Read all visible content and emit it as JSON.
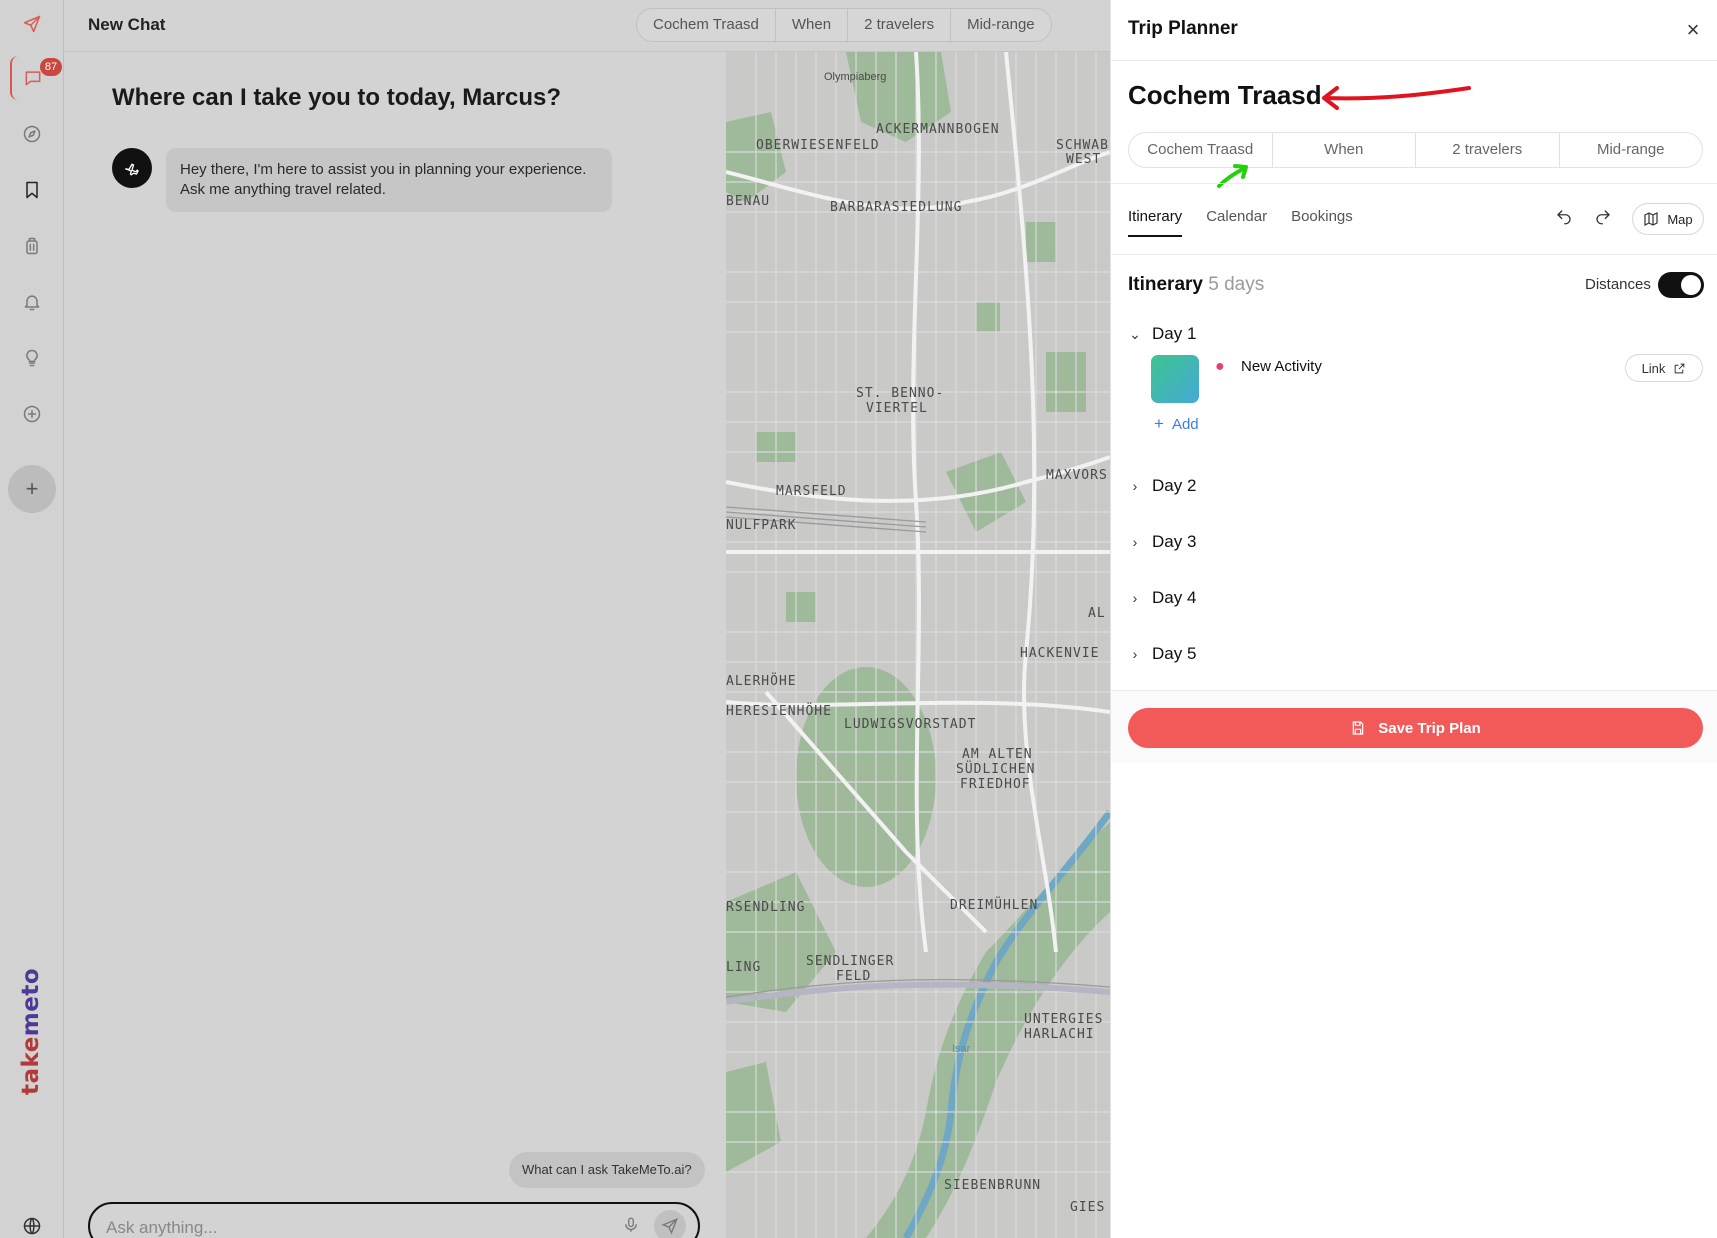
{
  "rail": {
    "badge_count": "87",
    "logo_part1": "take",
    "logo_part2": "meto"
  },
  "topbar": {
    "title": "New Chat",
    "pills": [
      "Cochem Traasd",
      "When",
      "2 travelers",
      "Mid-range"
    ]
  },
  "chat": {
    "greeting": "Where can I take you to today, Marcus?",
    "bot_message": "Hey there, I'm here to assist you in planning your experience. Ask me anything travel related.",
    "suggestion": "What can I ask TakeMeTo.ai?",
    "input_placeholder": "Ask anything..."
  },
  "map": {
    "labels": [
      "Olympiaberg",
      "ACKERMANNBOGEN",
      "OBERWIESENFELD",
      "SCHWABI",
      "WEST",
      "BENAU",
      "BARBARASIEDLUNG",
      "ST. BENNO-",
      "VIERTEL",
      "MARSFELD",
      "MAXVORS",
      "NULFPARK",
      "AL",
      "HACKENVIE",
      "ALERHÖHE",
      "HERESIENHÖHE",
      "LUDWIGSVORSTADT",
      "AM ALTEN",
      "SÜDLICHEN",
      "FRIEDHOF",
      "RSENDLING",
      "DREIMÜHLEN",
      "LING",
      "SENDLINGER",
      "FELD",
      "UNTERGIES",
      "HARLACHI",
      "SIEBENBRUNN",
      "GIES",
      "Isar"
    ]
  },
  "panel": {
    "title": "Trip Planner",
    "trip_name": "Cochem Traasd",
    "trip_tabs": [
      "Cochem Traasd",
      "When",
      "2 travelers",
      "Mid-range"
    ],
    "view_tabs": [
      "Itinerary",
      "Calendar",
      "Bookings"
    ],
    "map_button": "Map",
    "itinerary_title": "Itinerary",
    "itinerary_days": "5 days",
    "distances_label": "Distances",
    "distances_on": true,
    "days": [
      "Day 1",
      "Day 2",
      "Day 3",
      "Day 4",
      "Day 5"
    ],
    "activity": {
      "name": "New Activity",
      "link_label": "Link"
    },
    "add_label": "Add",
    "save_label": "Save Trip Plan"
  },
  "colors": {
    "save_button": "#f25a5a",
    "badge": "#c9473f",
    "add_link": "#3c7ee0",
    "annotation_red": "#e0141e",
    "annotation_green": "#22d10a"
  }
}
